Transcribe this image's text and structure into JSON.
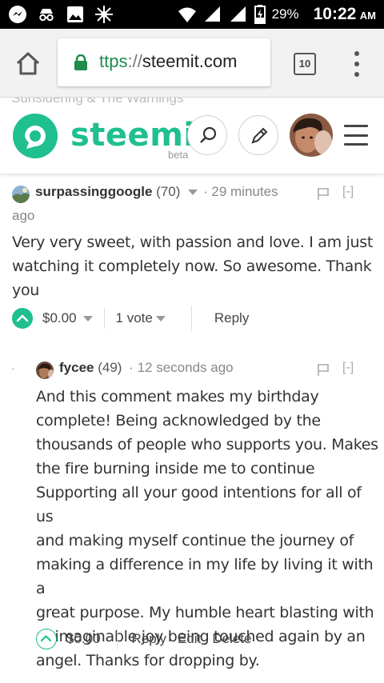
{
  "status_bar": {
    "battery_percent": "29%",
    "time": "10:22",
    "ampm": "AM",
    "icons": [
      "messenger-icon",
      "incognito-icon",
      "gallery-icon",
      "sparkle-icon",
      "wifi-icon",
      "signal-icon",
      "signal-icon",
      "battery-charging-icon"
    ]
  },
  "browser": {
    "url_scheme": "ttps",
    "url_sep": "://",
    "url_host": "steemit.com",
    "tab_count": "10"
  },
  "site_header": {
    "ghost_text": "Sunsidering & The Warnings",
    "logo_text": "steemit",
    "beta_label": "beta",
    "brand_color": "#1fbf8f"
  },
  "comments": [
    {
      "author": "surpassinggoogle",
      "reputation": "(70)",
      "time_ago_line1": "· 29 minutes",
      "time_ago_line2": "ago",
      "collapse": "[-]",
      "body_lines": [
        "Very very sweet, with passion and love. I am just",
        "watching it completely now. So awesome. Thank",
        "you"
      ],
      "payout": "$0.00",
      "votes": "1 vote",
      "reply_label": "Reply",
      "upvoted": true
    },
    {
      "author": "fycee",
      "reputation": "(49)",
      "time_ago": "· 12 seconds ago",
      "collapse": "[-]",
      "body_lines": [
        "And this comment makes my birthday",
        "complete! Being acknowledged by the",
        "thousands of people who supports you. Makes",
        "the fire burning inside me to continue",
        "Supporting all your good intentions for all of us",
        "and making myself continue the journey of",
        "making a difference in my life by living it with a",
        "great purpose. My humble heart blasting with",
        "unimaginable joy being touched again by an",
        "angel. Thanks for dropping by."
      ],
      "payout": "$0.00",
      "reply_label": "Reply",
      "edit_label": "Edit",
      "delete_label": "Delete",
      "upvoted": false
    }
  ]
}
